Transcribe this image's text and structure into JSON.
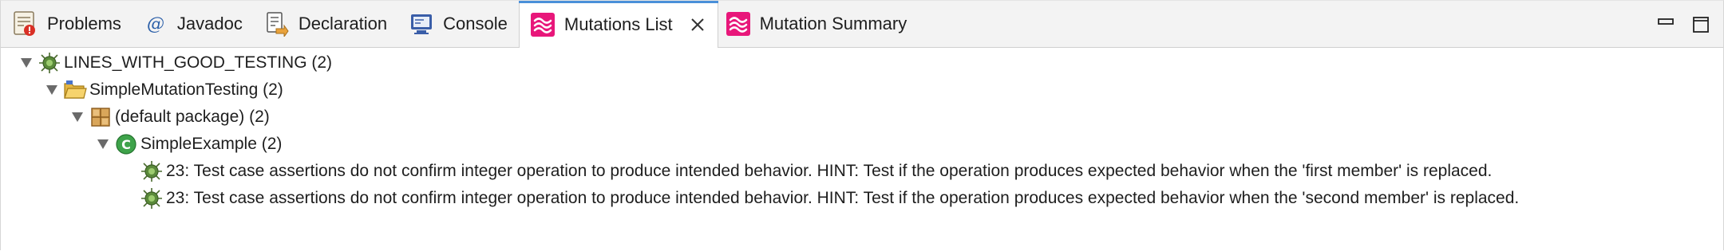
{
  "tabs": [
    {
      "label": "Problems",
      "icon": "problems-icon"
    },
    {
      "label": "Javadoc",
      "icon": "javadoc-icon"
    },
    {
      "label": "Declaration",
      "icon": "declaration-icon"
    },
    {
      "label": "Console",
      "icon": "console-icon"
    },
    {
      "label": "Mutations List",
      "icon": "mutations-icon",
      "active": true,
      "closable": true
    },
    {
      "label": "Mutation Summary",
      "icon": "mutations-icon"
    }
  ],
  "window_controls": [
    "minimize-icon",
    "maximize-icon"
  ],
  "tree": [
    {
      "label": "LINES_WITH_GOOD_TESTING (2)",
      "icon": "mutant-bug-icon",
      "expanded": true
    },
    {
      "label": "SimpleMutationTesting (2)",
      "icon": "project-folder-icon",
      "expanded": true
    },
    {
      "label": "(default package) (2)",
      "icon": "package-icon",
      "expanded": true
    },
    {
      "label": "SimpleExample (2)",
      "icon": "class-icon",
      "expanded": true
    },
    {
      "label": "23: Test case assertions do not confirm integer operation to produce intended behavior. HINT: Test if the operation produces expected behavior when the 'first member' is replaced.",
      "icon": "mutant-bug-icon"
    },
    {
      "label": "23: Test case assertions do not confirm integer operation to produce intended behavior. HINT: Test if the operation produces expected behavior when the 'second member' is replaced.",
      "icon": "mutant-bug-icon"
    }
  ],
  "colors": {
    "accent": "#e8177a",
    "active_tab_indicator": "#4a90d9",
    "bug_green": "#5a8a3a",
    "folder_yellow": "#f0c048",
    "class_green": "#3ea34a",
    "console_blue": "#3a5ea8"
  }
}
